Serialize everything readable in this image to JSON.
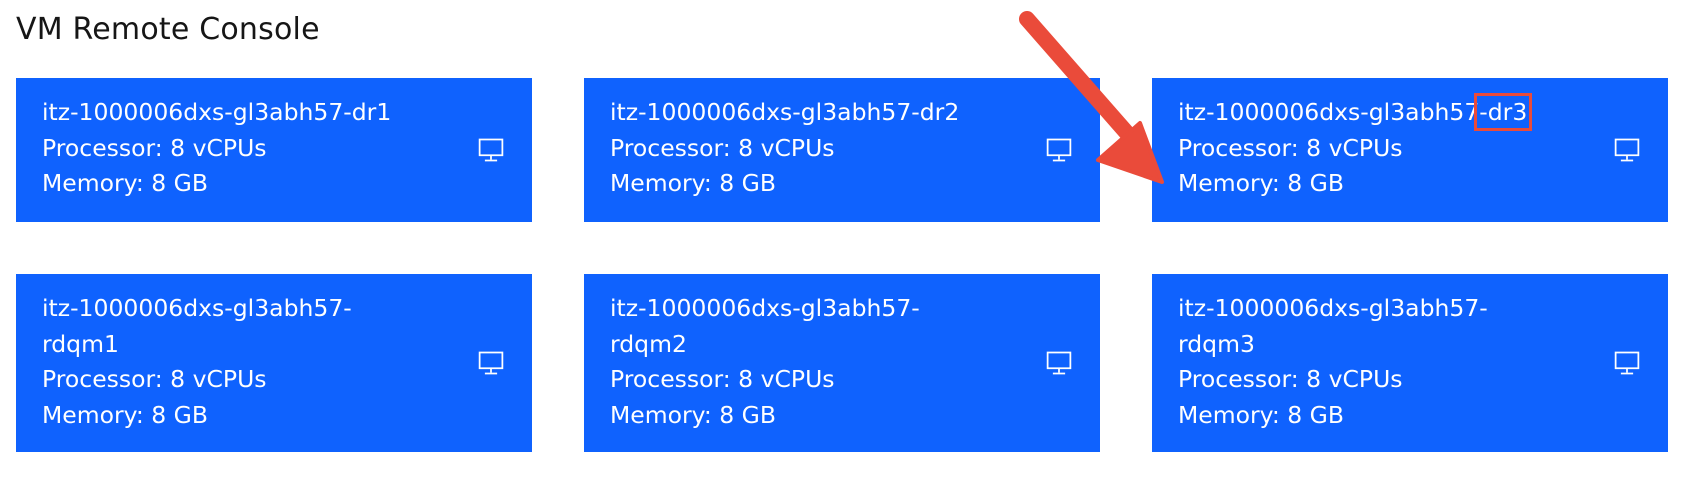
{
  "page": {
    "title": "VM Remote Console"
  },
  "vms": [
    {
      "name": "itz-1000006dxs-gl3abh57-dr1",
      "processor": "Processor: 8 vCPUs",
      "memory": "Memory: 8 GB",
      "icon": "monitor-icon"
    },
    {
      "name": "itz-1000006dxs-gl3abh57-dr2",
      "processor": "Processor: 8 vCPUs",
      "memory": "Memory: 8 GB",
      "icon": "monitor-icon"
    },
    {
      "name_prefix": "itz-1000006dxs-gl3abh57",
      "name_highlight": "-dr3",
      "processor": "Processor: 8 vCPUs",
      "memory": "Memory: 8 GB",
      "icon": "monitor-icon"
    },
    {
      "name_line1": "itz-1000006dxs-gl3abh57-",
      "name_line2": "rdqm1",
      "processor": "Processor: 8 vCPUs",
      "memory": "Memory: 8 GB",
      "icon": "monitor-icon"
    },
    {
      "name_line1": "itz-1000006dxs-gl3abh57-",
      "name_line2": "rdqm2",
      "processor": "Processor: 8 vCPUs",
      "memory": "Memory: 8 GB",
      "icon": "monitor-icon"
    },
    {
      "name_line1": "itz-1000006dxs-gl3abh57-",
      "name_line2": "rdqm3",
      "processor": "Processor: 8 vCPUs",
      "memory": "Memory: 8 GB",
      "icon": "monitor-icon"
    }
  ],
  "colors": {
    "tile_background": "#0f62fe",
    "tile_text": "#ffffff",
    "annotation": "#ea4b3a",
    "title_text": "#161616"
  },
  "annotation": {
    "type": "arrow-and-box",
    "target": "vms.2.name_highlight"
  }
}
